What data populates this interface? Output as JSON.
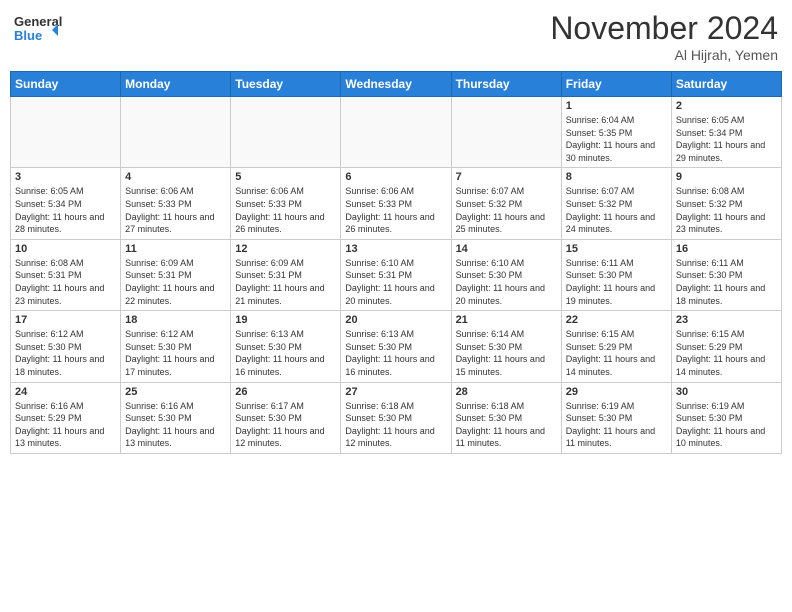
{
  "header": {
    "logo_line1": "General",
    "logo_line2": "Blue",
    "month": "November 2024",
    "location": "Al Hijrah, Yemen"
  },
  "weekdays": [
    "Sunday",
    "Monday",
    "Tuesday",
    "Wednesday",
    "Thursday",
    "Friday",
    "Saturday"
  ],
  "weeks": [
    [
      {
        "day": "",
        "sunrise": "",
        "sunset": "",
        "daylight": ""
      },
      {
        "day": "",
        "sunrise": "",
        "sunset": "",
        "daylight": ""
      },
      {
        "day": "",
        "sunrise": "",
        "sunset": "",
        "daylight": ""
      },
      {
        "day": "",
        "sunrise": "",
        "sunset": "",
        "daylight": ""
      },
      {
        "day": "",
        "sunrise": "",
        "sunset": "",
        "daylight": ""
      },
      {
        "day": "1",
        "sunrise": "Sunrise: 6:04 AM",
        "sunset": "Sunset: 5:35 PM",
        "daylight": "Daylight: 11 hours and 30 minutes."
      },
      {
        "day": "2",
        "sunrise": "Sunrise: 6:05 AM",
        "sunset": "Sunset: 5:34 PM",
        "daylight": "Daylight: 11 hours and 29 minutes."
      }
    ],
    [
      {
        "day": "3",
        "sunrise": "Sunrise: 6:05 AM",
        "sunset": "Sunset: 5:34 PM",
        "daylight": "Daylight: 11 hours and 28 minutes."
      },
      {
        "day": "4",
        "sunrise": "Sunrise: 6:06 AM",
        "sunset": "Sunset: 5:33 PM",
        "daylight": "Daylight: 11 hours and 27 minutes."
      },
      {
        "day": "5",
        "sunrise": "Sunrise: 6:06 AM",
        "sunset": "Sunset: 5:33 PM",
        "daylight": "Daylight: 11 hours and 26 minutes."
      },
      {
        "day": "6",
        "sunrise": "Sunrise: 6:06 AM",
        "sunset": "Sunset: 5:33 PM",
        "daylight": "Daylight: 11 hours and 26 minutes."
      },
      {
        "day": "7",
        "sunrise": "Sunrise: 6:07 AM",
        "sunset": "Sunset: 5:32 PM",
        "daylight": "Daylight: 11 hours and 25 minutes."
      },
      {
        "day": "8",
        "sunrise": "Sunrise: 6:07 AM",
        "sunset": "Sunset: 5:32 PM",
        "daylight": "Daylight: 11 hours and 24 minutes."
      },
      {
        "day": "9",
        "sunrise": "Sunrise: 6:08 AM",
        "sunset": "Sunset: 5:32 PM",
        "daylight": "Daylight: 11 hours and 23 minutes."
      }
    ],
    [
      {
        "day": "10",
        "sunrise": "Sunrise: 6:08 AM",
        "sunset": "Sunset: 5:31 PM",
        "daylight": "Daylight: 11 hours and 23 minutes."
      },
      {
        "day": "11",
        "sunrise": "Sunrise: 6:09 AM",
        "sunset": "Sunset: 5:31 PM",
        "daylight": "Daylight: 11 hours and 22 minutes."
      },
      {
        "day": "12",
        "sunrise": "Sunrise: 6:09 AM",
        "sunset": "Sunset: 5:31 PM",
        "daylight": "Daylight: 11 hours and 21 minutes."
      },
      {
        "day": "13",
        "sunrise": "Sunrise: 6:10 AM",
        "sunset": "Sunset: 5:31 PM",
        "daylight": "Daylight: 11 hours and 20 minutes."
      },
      {
        "day": "14",
        "sunrise": "Sunrise: 6:10 AM",
        "sunset": "Sunset: 5:30 PM",
        "daylight": "Daylight: 11 hours and 20 minutes."
      },
      {
        "day": "15",
        "sunrise": "Sunrise: 6:11 AM",
        "sunset": "Sunset: 5:30 PM",
        "daylight": "Daylight: 11 hours and 19 minutes."
      },
      {
        "day": "16",
        "sunrise": "Sunrise: 6:11 AM",
        "sunset": "Sunset: 5:30 PM",
        "daylight": "Daylight: 11 hours and 18 minutes."
      }
    ],
    [
      {
        "day": "17",
        "sunrise": "Sunrise: 6:12 AM",
        "sunset": "Sunset: 5:30 PM",
        "daylight": "Daylight: 11 hours and 18 minutes."
      },
      {
        "day": "18",
        "sunrise": "Sunrise: 6:12 AM",
        "sunset": "Sunset: 5:30 PM",
        "daylight": "Daylight: 11 hours and 17 minutes."
      },
      {
        "day": "19",
        "sunrise": "Sunrise: 6:13 AM",
        "sunset": "Sunset: 5:30 PM",
        "daylight": "Daylight: 11 hours and 16 minutes."
      },
      {
        "day": "20",
        "sunrise": "Sunrise: 6:13 AM",
        "sunset": "Sunset: 5:30 PM",
        "daylight": "Daylight: 11 hours and 16 minutes."
      },
      {
        "day": "21",
        "sunrise": "Sunrise: 6:14 AM",
        "sunset": "Sunset: 5:30 PM",
        "daylight": "Daylight: 11 hours and 15 minutes."
      },
      {
        "day": "22",
        "sunrise": "Sunrise: 6:15 AM",
        "sunset": "Sunset: 5:29 PM",
        "daylight": "Daylight: 11 hours and 14 minutes."
      },
      {
        "day": "23",
        "sunrise": "Sunrise: 6:15 AM",
        "sunset": "Sunset: 5:29 PM",
        "daylight": "Daylight: 11 hours and 14 minutes."
      }
    ],
    [
      {
        "day": "24",
        "sunrise": "Sunrise: 6:16 AM",
        "sunset": "Sunset: 5:29 PM",
        "daylight": "Daylight: 11 hours and 13 minutes."
      },
      {
        "day": "25",
        "sunrise": "Sunrise: 6:16 AM",
        "sunset": "Sunset: 5:30 PM",
        "daylight": "Daylight: 11 hours and 13 minutes."
      },
      {
        "day": "26",
        "sunrise": "Sunrise: 6:17 AM",
        "sunset": "Sunset: 5:30 PM",
        "daylight": "Daylight: 11 hours and 12 minutes."
      },
      {
        "day": "27",
        "sunrise": "Sunrise: 6:18 AM",
        "sunset": "Sunset: 5:30 PM",
        "daylight": "Daylight: 11 hours and 12 minutes."
      },
      {
        "day": "28",
        "sunrise": "Sunrise: 6:18 AM",
        "sunset": "Sunset: 5:30 PM",
        "daylight": "Daylight: 11 hours and 11 minutes."
      },
      {
        "day": "29",
        "sunrise": "Sunrise: 6:19 AM",
        "sunset": "Sunset: 5:30 PM",
        "daylight": "Daylight: 11 hours and 11 minutes."
      },
      {
        "day": "30",
        "sunrise": "Sunrise: 6:19 AM",
        "sunset": "Sunset: 5:30 PM",
        "daylight": "Daylight: 11 hours and 10 minutes."
      }
    ]
  ]
}
